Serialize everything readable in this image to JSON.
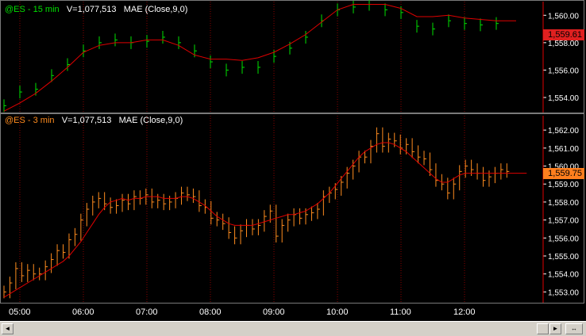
{
  "colors": {
    "background": "#000000",
    "top_bars": "#00e000",
    "bottom_bars": "#ff8c1e",
    "mae_line": "#e00000",
    "grid": "#8b0000",
    "axis_text": "#ffffff",
    "top_tag_bg": "#e02020",
    "bottom_tag_bg": "#ff7f1e"
  },
  "top_pane": {
    "symbol": "@ES - 15 min",
    "volume": "V=1,077,513",
    "indicator": "MAE (Close,9,0)",
    "last_price": "1,559.61",
    "y_ticks": [
      "1,560.00",
      "1,558.00",
      "1,556.00",
      "1,554.00"
    ]
  },
  "bottom_pane": {
    "symbol": "@ES - 3 min",
    "volume": "V=1,077,513",
    "indicator": "MAE (Close,9,0)",
    "last_price": "1,559.75",
    "y_ticks": [
      "1,562.00",
      "1,561.00",
      "1,560.00",
      "1,559.00",
      "1,558.00",
      "1,557.00",
      "1,556.00",
      "1,555.00",
      "1,554.00",
      "1,553.00"
    ]
  },
  "time_axis": {
    "labels": [
      "05:00",
      "06:00",
      "07:00",
      "08:00",
      "09:00",
      "10:00",
      "11:00",
      "12:00"
    ]
  },
  "scrollbar": {
    "left_arrow": "◄",
    "right_arrow": "►",
    "zoom_label": "↔"
  },
  "chart_data": [
    {
      "type": "line",
      "title": "@ES - 15 min",
      "series": [
        {
          "name": "Close",
          "kind": "tick-bars",
          "times": [
            "04:45",
            "05:00",
            "05:15",
            "05:30",
            "05:45",
            "06:00",
            "06:15",
            "06:30",
            "06:45",
            "07:00",
            "07:15",
            "07:30",
            "07:45",
            "08:00",
            "08:15",
            "08:30",
            "08:45",
            "09:00",
            "09:15",
            "09:30",
            "09:45",
            "10:00",
            "10:15",
            "10:30",
            "10:45",
            "11:00",
            "11:15",
            "11:30",
            "11:45",
            "12:00",
            "12:15",
            "12:30"
          ],
          "values": [
            1553.4,
            1554.4,
            1554.6,
            1555.6,
            1556.4,
            1557.4,
            1558.0,
            1558.2,
            1558.0,
            1558.1,
            1558.4,
            1558.0,
            1557.4,
            1556.6,
            1556.0,
            1556.2,
            1556.2,
            1557.0,
            1557.6,
            1558.4,
            1559.6,
            1560.4,
            1560.6,
            1560.8,
            1560.4,
            1560.2,
            1559.2,
            1559.0,
            1559.6,
            1559.4,
            1559.3,
            1559.4
          ]
        },
        {
          "name": "MAE",
          "kind": "line",
          "times": [
            "04:45",
            "05:00",
            "05:15",
            "05:30",
            "05:45",
            "06:00",
            "06:15",
            "06:30",
            "06:45",
            "07:00",
            "07:15",
            "07:30",
            "07:45",
            "08:00",
            "08:15",
            "08:30",
            "08:45",
            "09:00",
            "09:15",
            "09:30",
            "09:45",
            "10:00",
            "10:15",
            "10:30",
            "10:45",
            "11:00",
            "11:15",
            "11:30",
            "11:45",
            "12:00",
            "12:15",
            "12:30"
          ],
          "values": [
            1553.0,
            1553.6,
            1554.3,
            1555.2,
            1556.2,
            1557.3,
            1557.8,
            1558.0,
            1558.0,
            1558.2,
            1558.2,
            1557.8,
            1557.1,
            1556.8,
            1556.8,
            1556.7,
            1556.9,
            1557.3,
            1557.9,
            1558.6,
            1559.5,
            1560.4,
            1560.8,
            1560.8,
            1560.8,
            1560.5,
            1559.9,
            1559.9,
            1560.0,
            1559.8,
            1559.7,
            1559.6
          ]
        }
      ],
      "ylim": [
        1552.9,
        1561.0
      ]
    },
    {
      "type": "line",
      "title": "@ES - 3 min",
      "series": [
        {
          "name": "Close",
          "kind": "hlc-bars",
          "x_start": "04:45",
          "x_end": "12:40",
          "values": [
            1553.0,
            1553.5,
            1554.3,
            1553.9,
            1554.2,
            1554.0,
            1554.0,
            1554.4,
            1554.8,
            1555.3,
            1555.2,
            1555.9,
            1556.2,
            1557.0,
            1557.6,
            1558.0,
            1558.2,
            1557.9,
            1557.7,
            1557.8,
            1558.1,
            1557.9,
            1558.3,
            1558.2,
            1558.4,
            1558.0,
            1558.1,
            1557.9,
            1558.0,
            1558.2,
            1558.5,
            1558.4,
            1558.3,
            1557.8,
            1557.7,
            1557.1,
            1557.0,
            1556.8,
            1556.3,
            1556.0,
            1556.4,
            1556.7,
            1556.5,
            1556.7,
            1557.2,
            1557.5,
            1556.1,
            1556.7,
            1557.0,
            1557.3,
            1557.1,
            1557.3,
            1557.4,
            1557.6,
            1558.3,
            1558.5,
            1558.7,
            1559.1,
            1559.6,
            1560.0,
            1560.5,
            1560.5,
            1561.1,
            1561.8,
            1561.1,
            1561.5,
            1561.4,
            1561.0,
            1561.2,
            1560.8,
            1560.5,
            1560.4,
            1559.8,
            1559.2,
            1559.0,
            1558.5,
            1559.0,
            1559.7,
            1560.0,
            1559.8,
            1559.6,
            1559.2,
            1559.4,
            1559.6,
            1559.8,
            1559.7
          ]
        },
        {
          "name": "MAE",
          "kind": "line",
          "x_start": "04:45",
          "x_end": "12:40",
          "values": [
            1552.7,
            1552.9,
            1553.1,
            1553.3,
            1553.5,
            1553.7,
            1553.9,
            1554.1,
            1554.3,
            1554.5,
            1554.7,
            1555.0,
            1555.4,
            1555.8,
            1556.3,
            1556.8,
            1557.3,
            1557.7,
            1558.0,
            1558.1,
            1558.2,
            1558.1,
            1558.2,
            1558.2,
            1558.3,
            1558.3,
            1558.3,
            1558.2,
            1558.2,
            1558.2,
            1558.3,
            1558.3,
            1558.2,
            1558.0,
            1557.8,
            1557.5,
            1557.2,
            1557.0,
            1556.8,
            1556.7,
            1556.7,
            1556.7,
            1556.7,
            1556.8,
            1556.9,
            1557.0,
            1557.1,
            1557.2,
            1557.3,
            1557.3,
            1557.4,
            1557.5,
            1557.7,
            1557.9,
            1558.2,
            1558.5,
            1558.9,
            1559.3,
            1559.7,
            1560.1,
            1560.5,
            1560.8,
            1561.0,
            1561.2,
            1561.3,
            1561.3,
            1561.2,
            1561.0,
            1560.8,
            1560.5,
            1560.2,
            1559.9,
            1559.6,
            1559.3,
            1559.1,
            1559.1,
            1559.3,
            1559.5,
            1559.6,
            1559.6,
            1559.6,
            1559.6,
            1559.6,
            1559.6,
            1559.6,
            1559.6
          ]
        }
      ],
      "ylim": [
        1552.4,
        1562.8
      ]
    }
  ]
}
